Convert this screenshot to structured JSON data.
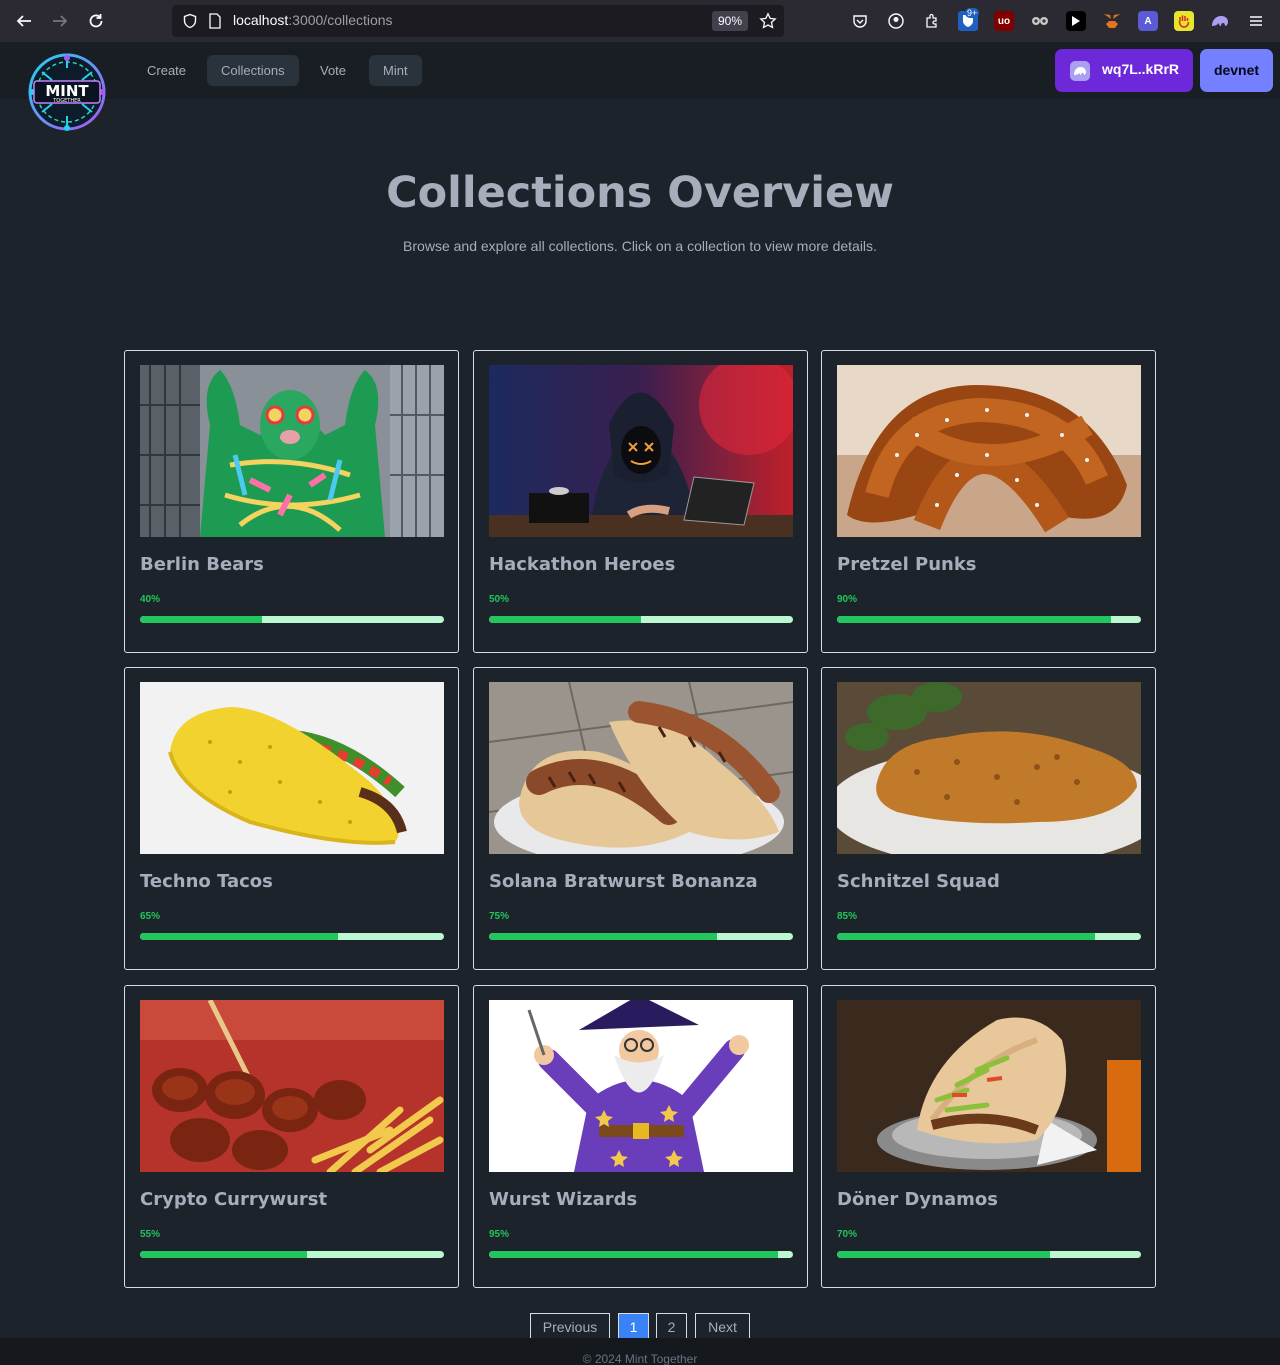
{
  "browser": {
    "url_host": "localhost",
    "url_path": ":3000/collections",
    "zoom": "90%",
    "ext_badge": "9+"
  },
  "navbar": {
    "logo_text": "MINT",
    "logo_subtext": "TOGETHER",
    "items": [
      {
        "label": "Create"
      },
      {
        "label": "Collections"
      },
      {
        "label": "Vote"
      },
      {
        "label": "Mint"
      }
    ],
    "wallet_label": "wq7L..kRrR",
    "network_label": "devnet"
  },
  "hero": {
    "title": "Collections Overview",
    "subtitle": "Browse and explore all collections. Click on a collection to view more details."
  },
  "collections": [
    {
      "name": "Berlin Bears",
      "progress_label": "40%",
      "progress": 0.4
    },
    {
      "name": "Hackathon Heroes",
      "progress_label": "50%",
      "progress": 0.5
    },
    {
      "name": "Pretzel Punks",
      "progress_label": "90%",
      "progress": 0.9
    },
    {
      "name": "Techno Tacos",
      "progress_label": "65%",
      "progress": 0.65
    },
    {
      "name": "Solana Bratwurst Bonanza",
      "progress_label": "75%",
      "progress": 0.75
    },
    {
      "name": "Schnitzel Squad",
      "progress_label": "85%",
      "progress": 0.85
    },
    {
      "name": "Crypto Currywurst",
      "progress_label": "55%",
      "progress": 0.55
    },
    {
      "name": "Wurst Wizards",
      "progress_label": "95%",
      "progress": 0.95
    },
    {
      "name": "Döner Dynamos",
      "progress_label": "70%",
      "progress": 0.7
    }
  ],
  "pagination": {
    "previous": "Previous",
    "pages": [
      "1",
      "2"
    ],
    "current": "1",
    "next": "Next"
  },
  "footer": {
    "text": "© 2024 Mint Together"
  },
  "colors": {
    "accent_purple": "#6d28d9",
    "network": "#7480ff",
    "progress_fill": "#22c55e",
    "progress_track": "#bbf7d0",
    "page_active": "#3b82f6"
  }
}
